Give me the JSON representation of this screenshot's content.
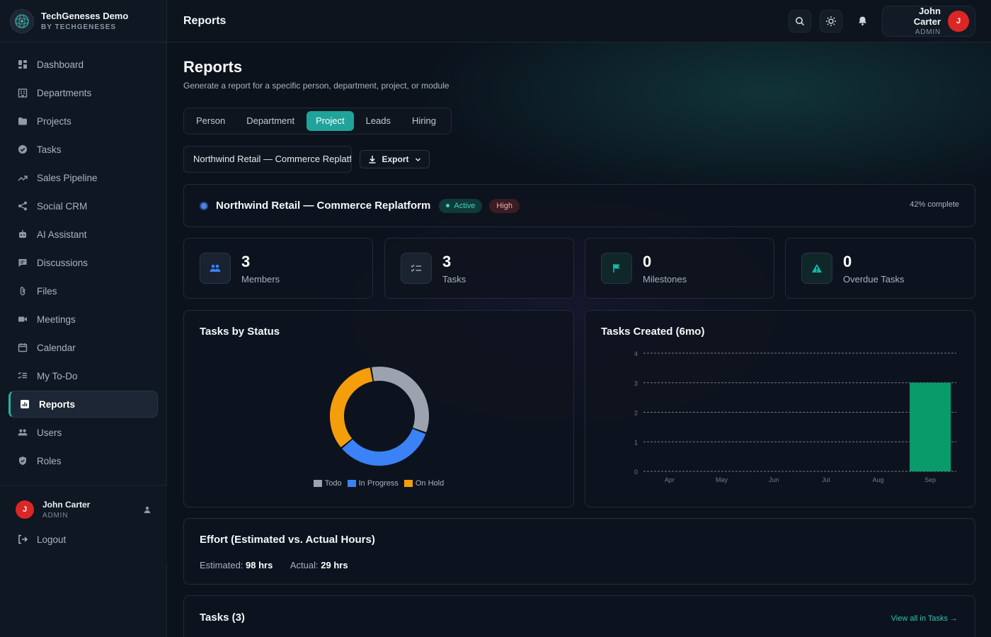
{
  "brand": {
    "name": "TechGeneses Demo",
    "sub": "BY TECHGENESES"
  },
  "sidebar": {
    "items": [
      {
        "label": "Dashboard",
        "icon": "dashboard-icon"
      },
      {
        "label": "Departments",
        "icon": "building-icon"
      },
      {
        "label": "Projects",
        "icon": "folder-icon"
      },
      {
        "label": "Tasks",
        "icon": "check-circle-icon"
      },
      {
        "label": "Sales Pipeline",
        "icon": "trend-icon"
      },
      {
        "label": "Social CRM",
        "icon": "share-icon"
      },
      {
        "label": "AI Assistant",
        "icon": "robot-icon"
      },
      {
        "label": "Discussions",
        "icon": "chat-icon"
      },
      {
        "label": "Files",
        "icon": "paperclip-icon"
      },
      {
        "label": "Meetings",
        "icon": "video-icon"
      },
      {
        "label": "Calendar",
        "icon": "calendar-icon"
      },
      {
        "label": "My To-Do",
        "icon": "checklist-icon"
      },
      {
        "label": "Reports",
        "icon": "report-icon",
        "active": true
      },
      {
        "label": "Users",
        "icon": "users-icon"
      },
      {
        "label": "Roles",
        "icon": "shield-icon"
      }
    ],
    "footer": {
      "user_name": "John Carter",
      "user_role": "ADMIN",
      "avatar_initial": "J",
      "logout_label": "Logout"
    }
  },
  "topbar": {
    "title": "Reports",
    "user_name": "John Carter",
    "user_role": "ADMIN",
    "avatar_initial": "J"
  },
  "page": {
    "title": "Reports",
    "subtitle": "Generate a report for a specific person, department, project, or module",
    "tabs": [
      "Person",
      "Department",
      "Project",
      "Leads",
      "Hiring"
    ],
    "active_tab": "Project",
    "selected_project": "Northwind Retail — Commerce Replatform",
    "export_label": "Export"
  },
  "project": {
    "name": "Northwind Retail — Commerce Replatform",
    "status": "Active",
    "priority": "High",
    "complete_text": "42% complete",
    "progress": 0.42
  },
  "stats": [
    {
      "value": "3",
      "label": "Members",
      "icon": "users-icon",
      "color": "#3b82f6"
    },
    {
      "value": "3",
      "label": "Tasks",
      "icon": "checklist-icon",
      "color": "#9aa3b2"
    },
    {
      "value": "0",
      "label": "Milestones",
      "icon": "flag-icon",
      "color": "#14b8a6"
    },
    {
      "value": "0",
      "label": "Overdue Tasks",
      "icon": "warning-icon",
      "color": "#14b8a6"
    }
  ],
  "tasks_by_status": {
    "title": "Tasks by Status",
    "legend": [
      "Todo",
      "In Progress",
      "On Hold"
    ]
  },
  "tasks_created": {
    "title": "Tasks Created (6mo)"
  },
  "chart_data": [
    {
      "type": "pie",
      "title": "Tasks by Status",
      "categories": [
        "Todo",
        "In Progress",
        "On Hold"
      ],
      "values": [
        1,
        1,
        1
      ],
      "colors": [
        "#9ca3af",
        "#3b82f6",
        "#f59e0b"
      ],
      "legend": "bottom"
    },
    {
      "type": "bar",
      "title": "Tasks Created (6mo)",
      "categories": [
        "Apr",
        "May",
        "Jun",
        "Jul",
        "Aug",
        "Sep"
      ],
      "values": [
        0,
        0,
        0,
        0,
        0,
        3
      ],
      "color": "#0a9b6a",
      "ylim": [
        0,
        4
      ],
      "yticks": [
        0,
        1,
        2,
        3,
        4
      ],
      "grid": true
    }
  ],
  "effort": {
    "title": "Effort (Estimated vs. Actual Hours)",
    "estimated_label": "Estimated:",
    "estimated_value": "98 hrs",
    "actual_label": "Actual:",
    "actual_value": "29 hrs"
  },
  "tasks_section": {
    "title": "Tasks (3)",
    "view_all": "View all in Tasks →"
  }
}
